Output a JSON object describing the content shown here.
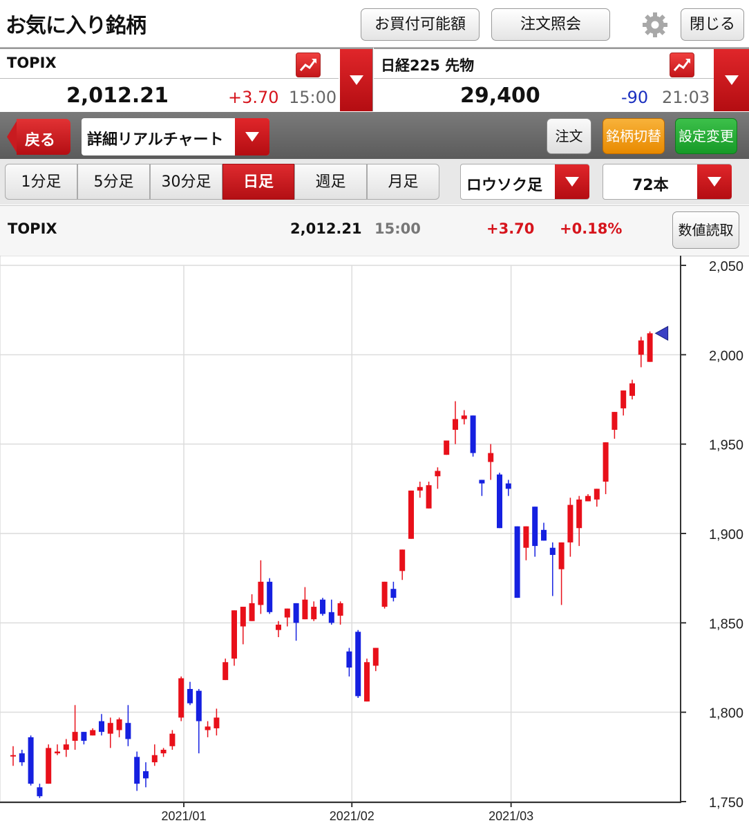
{
  "header": {
    "title": "お気に入り銘柄",
    "buy_power_label": "お買付可能額",
    "order_inquiry_label": "注文照会",
    "close_label": "閉じる"
  },
  "tickers": [
    {
      "name": "TOPIX",
      "price": "2,012.21",
      "change": "+3.70",
      "time": "15:00"
    },
    {
      "name": "日経225 先物",
      "price": "29,400",
      "change": "-90",
      "time": "21:03"
    }
  ],
  "toolbar": {
    "back_label": "戻る",
    "chart_select": "詳細リアルチャート",
    "order_label": "注文",
    "switch_label": "銘柄切替",
    "settings_label": "設定変更"
  },
  "periods": {
    "tabs": [
      "1分足",
      "5分足",
      "30分足",
      "日足",
      "週足",
      "月足"
    ],
    "active": "日足",
    "chart_type": "ロウソク足",
    "bars": "72本"
  },
  "info": {
    "name": "TOPIX",
    "price": "2,012.21",
    "time": "15:00",
    "change": "+3.70",
    "change_pct": "+0.18%",
    "read_values_label": "数値読取"
  },
  "colors": {
    "up": "#e8101a",
    "down": "#1520e0",
    "change_up": "#d6141c",
    "change_down": "#1a2fbf",
    "accent": "#c8161c"
  },
  "chart_data": {
    "type": "candlestick",
    "ylim": [
      1750,
      2050
    ],
    "yticks": [
      "1,750",
      "1,800",
      "1,850",
      "1,900",
      "1,950",
      "2,000",
      "2,050"
    ],
    "ytick_values": [
      1750,
      1800,
      1850,
      1900,
      1950,
      2000,
      2050
    ],
    "xtick_labels": [
      "2021/01",
      "2021/02",
      "2021/03"
    ],
    "xtick_index": [
      19.3,
      38.3,
      56.3
    ],
    "grid": true,
    "last_marker": "triangle",
    "candles": [
      [
        1776,
        1781,
        1770,
        1776
      ],
      [
        1777,
        1779,
        1770,
        1772
      ],
      [
        1786,
        1787,
        1759,
        1760
      ],
      [
        1758,
        1760,
        1752,
        1753
      ],
      [
        1760,
        1782,
        1760,
        1780
      ],
      [
        1777,
        1782,
        1776,
        1778
      ],
      [
        1779,
        1785,
        1775,
        1782
      ],
      [
        1784,
        1804,
        1779,
        1789
      ],
      [
        1789,
        1789,
        1782,
        1784
      ],
      [
        1787,
        1791,
        1787,
        1790
      ],
      [
        1795,
        1799,
        1787,
        1789
      ],
      [
        1788,
        1797,
        1780,
        1794
      ],
      [
        1790,
        1797,
        1786,
        1796
      ],
      [
        1794,
        1804,
        1781,
        1785
      ],
      [
        1775,
        1778,
        1756,
        1760
      ],
      [
        1767,
        1772,
        1758,
        1763
      ],
      [
        1772,
        1782,
        1770,
        1776
      ],
      [
        1777,
        1780,
        1775,
        1779
      ],
      [
        1781,
        1790,
        1779,
        1788
      ],
      [
        1797,
        1820,
        1795,
        1819
      ],
      [
        1813,
        1817,
        1804,
        1805
      ],
      [
        1812,
        1813,
        1777,
        1795
      ],
      [
        1790,
        1795,
        1786,
        1792
      ],
      [
        1791,
        1802,
        1787,
        1797
      ],
      [
        1818,
        1830,
        1818,
        1828
      ],
      [
        1830,
        1842,
        1826,
        1857
      ],
      [
        1848,
        1859,
        1838,
        1859
      ],
      [
        1851,
        1866,
        1851,
        1861
      ],
      [
        1860,
        1885,
        1855,
        1873
      ],
      [
        1873,
        1875,
        1855,
        1856
      ],
      [
        1846,
        1851,
        1842,
        1849
      ],
      [
        1853,
        1858,
        1848,
        1858
      ],
      [
        1861,
        1860,
        1840,
        1850
      ],
      [
        1852,
        1870,
        1852,
        1863
      ],
      [
        1852,
        1862,
        1851,
        1859
      ],
      [
        1863,
        1864,
        1854,
        1855
      ],
      [
        1856,
        1863,
        1849,
        1850
      ],
      [
        1854,
        1862,
        1849,
        1861
      ],
      [
        1834,
        1836,
        1820,
        1825
      ],
      [
        1845,
        1846,
        1808,
        1809
      ],
      [
        1806,
        1830,
        1806,
        1828
      ],
      [
        1826,
        1835,
        1823,
        1836
      ],
      [
        1859,
        1873,
        1858,
        1873
      ],
      [
        1869,
        1873,
        1862,
        1864
      ],
      [
        1879,
        1891,
        1874,
        1891
      ],
      [
        1897,
        1924,
        1897,
        1924
      ],
      [
        1924,
        1929,
        1920,
        1926
      ],
      [
        1914,
        1929,
        1914,
        1927
      ],
      [
        1932,
        1937,
        1925,
        1935
      ],
      [
        1944,
        1951,
        1944,
        1952
      ],
      [
        1958,
        1974,
        1950,
        1964
      ],
      [
        1964,
        1969,
        1961,
        1966
      ],
      [
        1966,
        1966,
        1943,
        1945
      ],
      [
        1930,
        1930,
        1921,
        1928
      ],
      [
        1940,
        1950,
        1930,
        1945
      ],
      [
        1933,
        1934,
        1903,
        1903
      ],
      [
        1928,
        1930,
        1921,
        1925
      ],
      [
        1904,
        1904,
        1864,
        1864
      ],
      [
        1892,
        1904,
        1885,
        1904
      ],
      [
        1915,
        1915,
        1887,
        1893
      ],
      [
        1902,
        1906,
        1896,
        1896
      ],
      [
        1892,
        1895,
        1865,
        1888
      ],
      [
        1880,
        1895,
        1860,
        1895
      ],
      [
        1895,
        1920,
        1887,
        1916
      ],
      [
        1903,
        1921,
        1893,
        1919
      ],
      [
        1918,
        1922,
        1918,
        1921
      ],
      [
        1919,
        1925,
        1915,
        1925
      ],
      [
        1929,
        1940,
        1922,
        1951
      ],
      [
        1958,
        1962,
        1953,
        1968
      ],
      [
        1970,
        1977,
        1966,
        1980
      ],
      [
        1977,
        1986,
        1975,
        1984
      ],
      [
        2000,
        2010,
        1993,
        2008
      ],
      [
        1996,
        2013,
        1996,
        2012
      ]
    ]
  }
}
